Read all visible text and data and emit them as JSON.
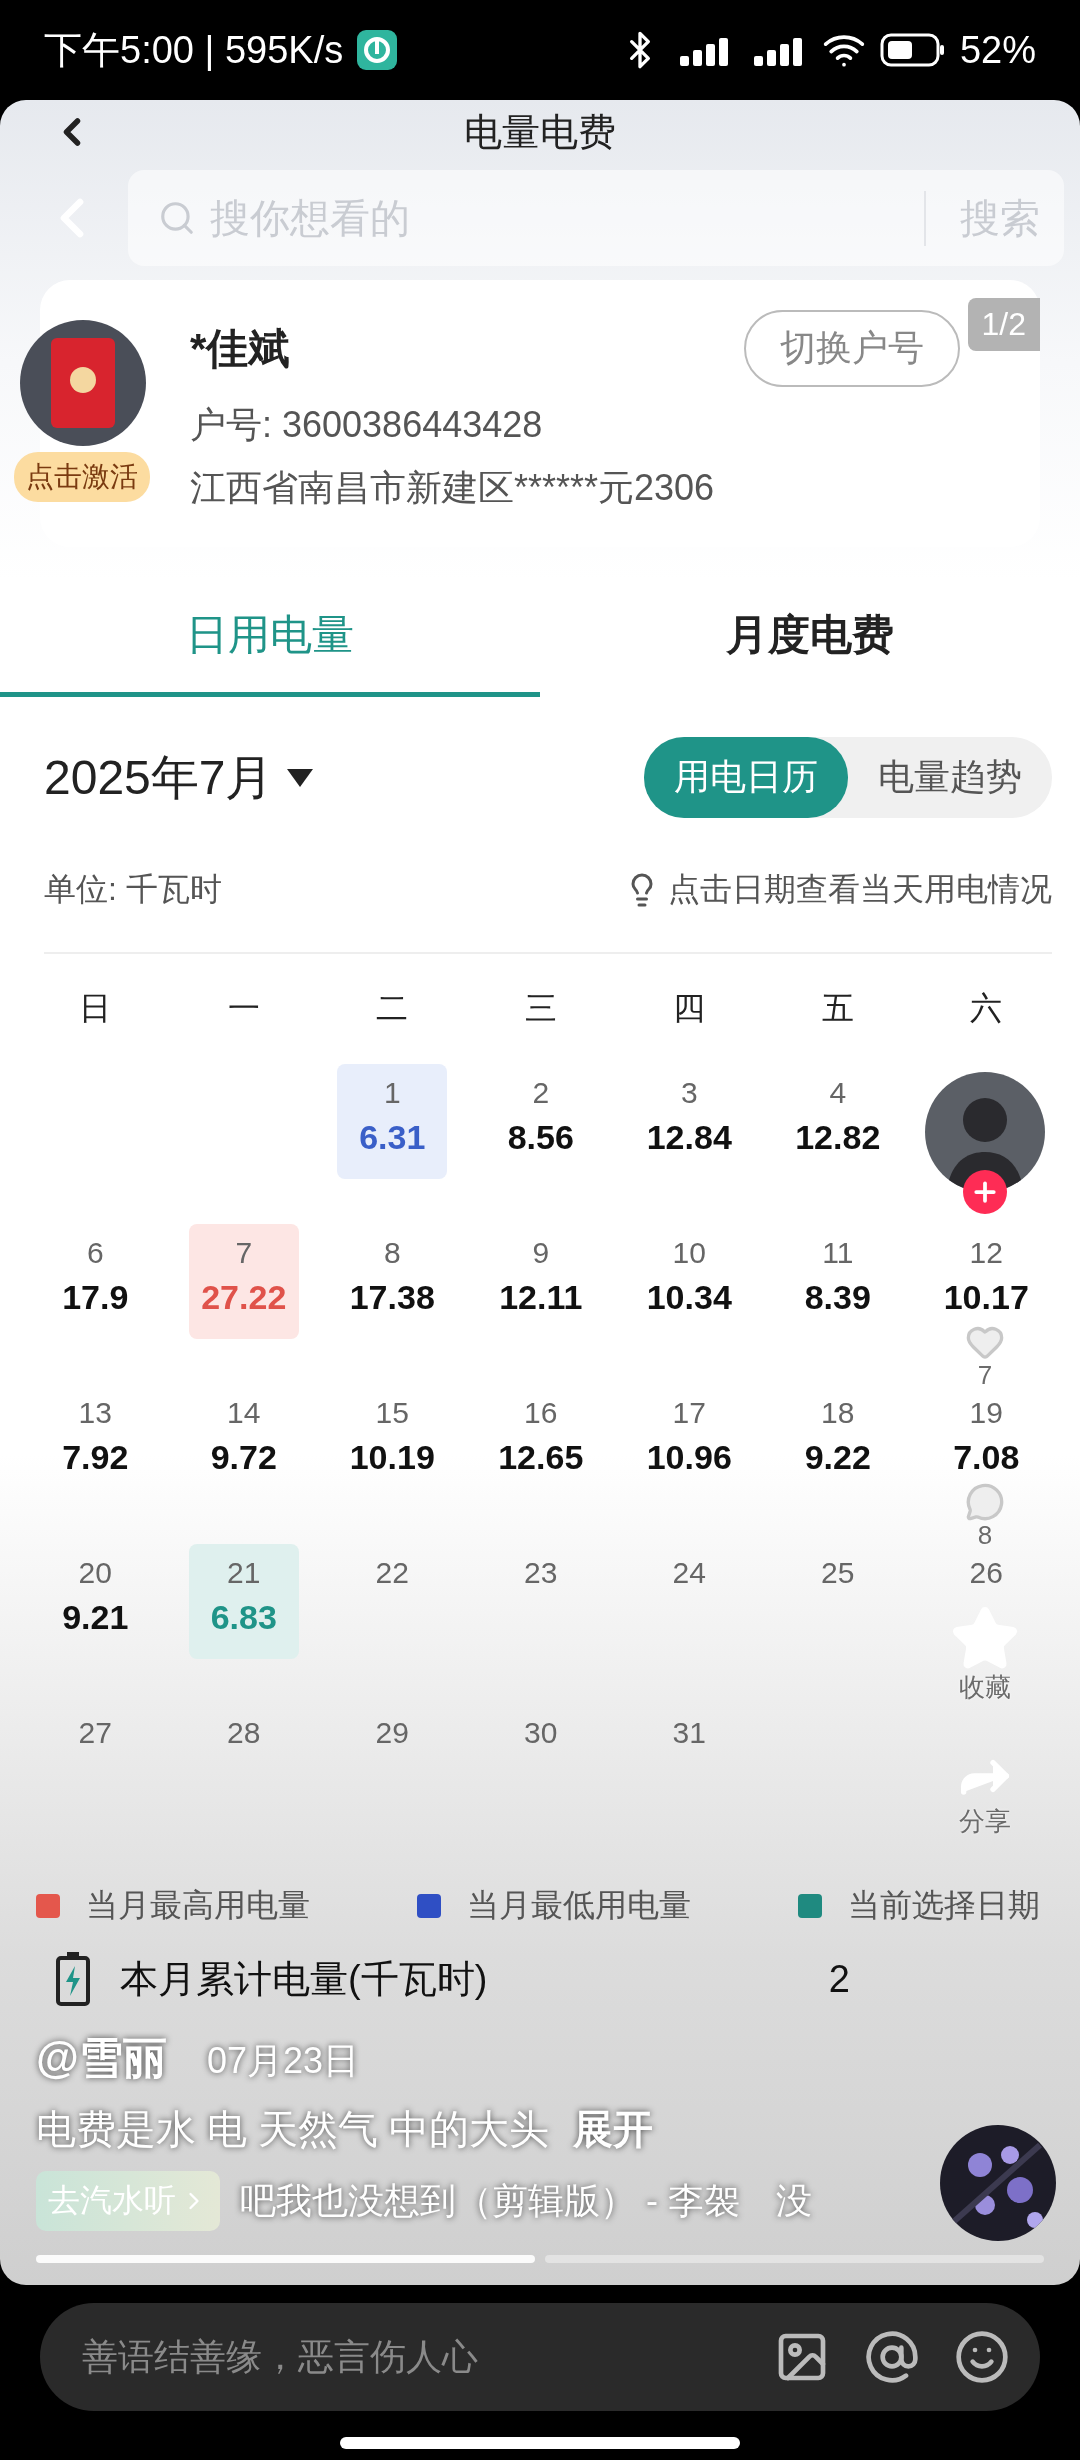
{
  "status_bar": {
    "time_speed": "下午5:00 | 595K/s",
    "battery": "52%"
  },
  "app_header": {
    "title": "电量电费"
  },
  "search_bar": {
    "placeholder": "搜你想看的",
    "button": "搜索"
  },
  "account_card": {
    "name": "*佳斌",
    "switch_button": "切换户号",
    "page_badge": "1/2",
    "account_number": "户号: 3600386443428",
    "address": "江西省南昌市新建区******元2306",
    "red_packet_badge": "点击激活"
  },
  "tabs": [
    {
      "label": "日用电量",
      "selected": true
    },
    {
      "label": "月度电费",
      "selected": false
    }
  ],
  "month_picker": {
    "label": "2025年7月"
  },
  "view_toggle": [
    {
      "label": "用电日历",
      "selected": true
    },
    {
      "label": "电量趋势",
      "selected": false
    }
  ],
  "unit": "单位: 千瓦时",
  "hint": "点击日期查看当天用电情况",
  "weekdays": [
    "日",
    "一",
    "二",
    "三",
    "四",
    "五",
    "六"
  ],
  "days": [
    {
      "kind": "blank"
    },
    {
      "kind": "blank"
    },
    {
      "day": "1",
      "value": "6.31",
      "kind": "low"
    },
    {
      "day": "2",
      "value": "8.56",
      "kind": "normal"
    },
    {
      "day": "3",
      "value": "12.84",
      "kind": "normal"
    },
    {
      "day": "4",
      "value": "12.82",
      "kind": "normal"
    },
    {
      "kind": "blank"
    },
    {
      "day": "6",
      "value": "17.9",
      "kind": "normal"
    },
    {
      "day": "7",
      "value": "27.22",
      "kind": "high"
    },
    {
      "day": "8",
      "value": "17.38",
      "kind": "normal"
    },
    {
      "day": "9",
      "value": "12.11",
      "kind": "normal"
    },
    {
      "day": "10",
      "value": "10.34",
      "kind": "normal"
    },
    {
      "day": "11",
      "value": "8.39",
      "kind": "normal"
    },
    {
      "day": "12",
      "value": "10.17",
      "kind": "normal"
    },
    {
      "day": "13",
      "value": "7.92",
      "kind": "normal"
    },
    {
      "day": "14",
      "value": "9.72",
      "kind": "normal"
    },
    {
      "day": "15",
      "value": "10.19",
      "kind": "normal"
    },
    {
      "day": "16",
      "value": "12.65",
      "kind": "normal"
    },
    {
      "day": "17",
      "value": "10.96",
      "kind": "normal"
    },
    {
      "day": "18",
      "value": "9.22",
      "kind": "normal"
    },
    {
      "day": "19",
      "value": "7.08",
      "kind": "normal"
    },
    {
      "day": "20",
      "value": "9.21",
      "kind": "normal"
    },
    {
      "day": "21",
      "value": "6.83",
      "kind": "selected"
    },
    {
      "day": "22",
      "kind": "normal"
    },
    {
      "day": "23",
      "kind": "normal"
    },
    {
      "day": "24",
      "kind": "normal"
    },
    {
      "day": "25",
      "kind": "normal"
    },
    {
      "day": "26",
      "kind": "normal"
    },
    {
      "day": "27",
      "kind": "normal"
    },
    {
      "day": "28",
      "kind": "normal"
    },
    {
      "day": "29",
      "kind": "normal"
    },
    {
      "day": "30",
      "kind": "normal"
    },
    {
      "day": "31",
      "kind": "normal"
    }
  ],
  "legend": [
    {
      "label": "当月最高用电量",
      "color": "#e4574c"
    },
    {
      "label": "当月最低用电量",
      "color": "#2f4fc4"
    },
    {
      "label": "当前选择日期",
      "color": "#1f8a80"
    }
  ],
  "summary": {
    "label": "本月累计电量(千瓦时)",
    "value": "2"
  },
  "video_overlay": {
    "author": "@雪丽",
    "date": "07月23日",
    "caption": "电费是水 电 天然气 中的大头",
    "expand": "展开",
    "music_chip": "去汽水听",
    "music": "吧我也没想到（剪辑版） - 李袈　没",
    "segments": [
      {
        "done": true
      },
      {
        "done": false
      }
    ]
  },
  "side_rail": {
    "like_count": "7",
    "comment_count": "8",
    "favorite": "收藏",
    "share": "分享"
  },
  "comment_bar": {
    "placeholder": "善语结善缘，恶言伤人心"
  }
}
